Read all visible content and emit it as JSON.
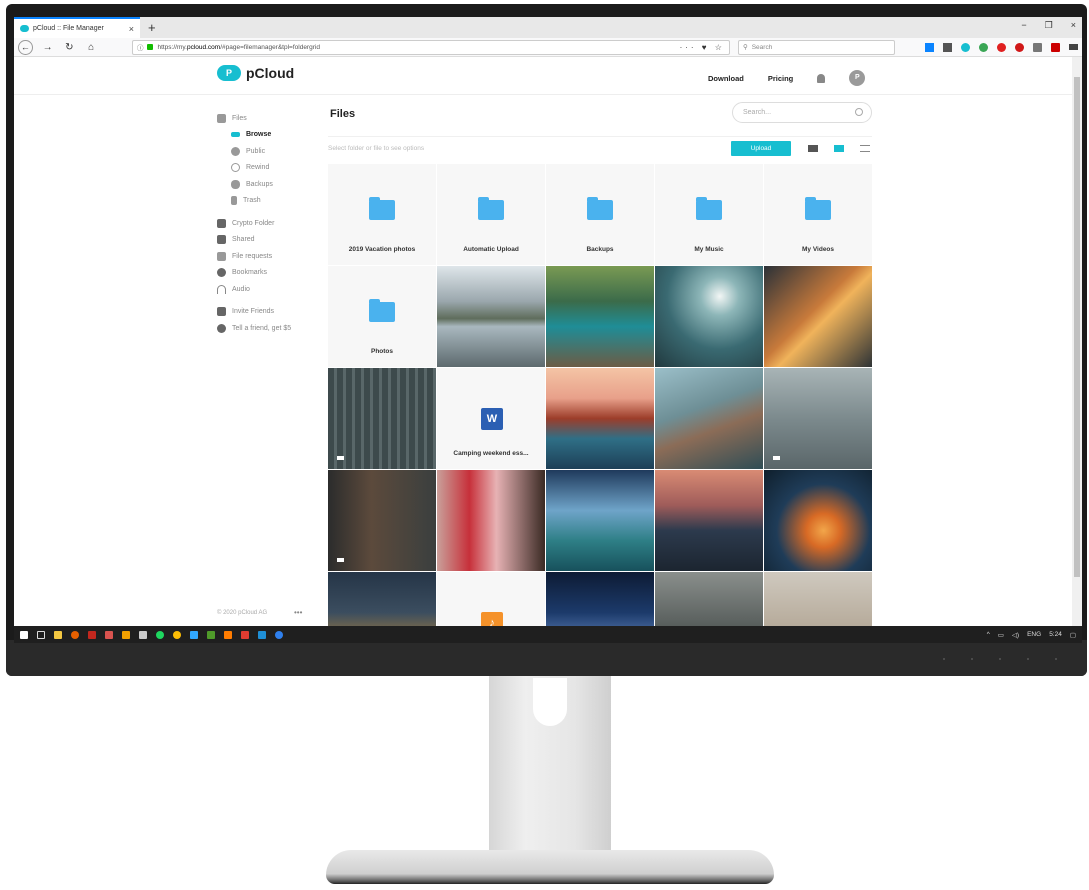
{
  "browser": {
    "tab_title": "pCloud :: File Manager",
    "tab_close": "×",
    "new_tab": "+",
    "url_host": "https://my.",
    "url_domain": "pcloud.com",
    "url_path": "/#page=filemanager&tpl=foldergrid",
    "page_actions": "··· ♥ ☆",
    "search_placeholder": "Search",
    "win_min": "−",
    "win_max": "❐",
    "win_close": "×"
  },
  "header": {
    "logo_mark": "P",
    "logo_text": "pCloud",
    "nav_download": "Download",
    "nav_pricing": "Pricing",
    "avatar_letter": "P"
  },
  "sidebar": {
    "files": "Files",
    "browse": "Browse",
    "public": "Public",
    "rewind": "Rewind",
    "backups": "Backups",
    "trash": "Trash",
    "crypto": "Crypto Folder",
    "shared": "Shared",
    "file_requests": "File requests",
    "bookmarks": "Bookmarks",
    "audio": "Audio",
    "invite": "Invite Friends",
    "tell": "Tell a friend, get $5",
    "footer": "© 2020 pCloud AG",
    "footer_more": "•••"
  },
  "main": {
    "title": "Files",
    "search_placeholder": "Search...",
    "hint": "Select folder or file to see options",
    "upload": "Upload"
  },
  "grid": {
    "folder1": "2019 Vacation photos",
    "folder2": "Automatic Upload",
    "folder3": "Backups",
    "folder4": "My Music",
    "folder5": "My Videos",
    "folder6": "Photos",
    "doc_label": "Camping weekend ess...",
    "word_letter": "W",
    "music_glyph": "♪"
  },
  "taskbar": {
    "lang": "ENG",
    "time": "5:24"
  },
  "colors": {
    "brand": "#17bed0",
    "folder": "#4ab2ee"
  }
}
